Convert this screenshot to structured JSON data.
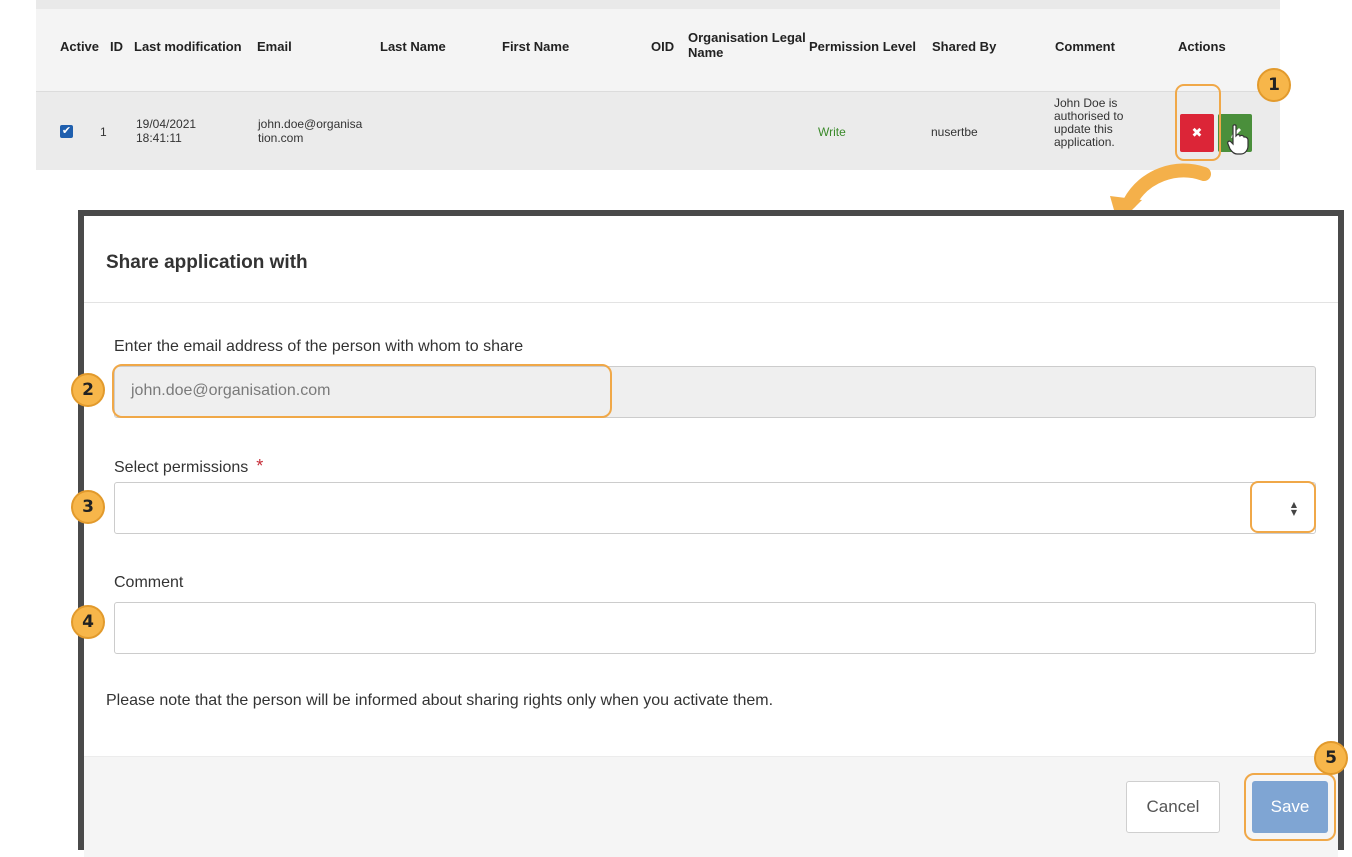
{
  "table": {
    "headers": {
      "active": "Active",
      "id": "ID",
      "last_modification": "Last modification",
      "email": "Email",
      "last_name": "Last Name",
      "first_name": "First Name",
      "oid": "OID",
      "org_legal_name_1": "Organisation Legal",
      "org_legal_name_2": "Name",
      "permission_level": "Permission Level",
      "shared_by": "Shared By",
      "comment": "Comment",
      "actions": "Actions"
    },
    "rows": [
      {
        "active": true,
        "id": "1",
        "last_modification_date": "19/04/2021",
        "last_modification_time": "18:41:11",
        "email_1": "john.doe@organisa",
        "email_2": "tion.com",
        "last_name": "",
        "first_name": "",
        "oid": "",
        "org_legal_name": "",
        "permission_level": "Write",
        "shared_by": "nusertbe",
        "comment_lines": [
          "John Doe is",
          "authorised to",
          "update this",
          "application."
        ]
      }
    ]
  },
  "callouts": [
    "1",
    "2",
    "3",
    "4",
    "5"
  ],
  "modal": {
    "title": "Share application with",
    "email_label": "Enter the email address of the person with whom to share",
    "email_value": "john.doe@organisation.com",
    "permissions_label": "Select permissions",
    "permissions_required_mark": "*",
    "permissions_value": "",
    "comment_label": "Comment",
    "comment_value": "",
    "note": "Please note that the person will be informed about sharing rights only when you activate them.",
    "cancel_label": "Cancel",
    "save_label": "Save"
  },
  "colors": {
    "delete_button": "#dc2537",
    "edit_button": "#4a8f3b",
    "permission_write": "#3a8a2a",
    "callout": "#f7b64a",
    "required": "#c52a35",
    "save_button": "#7fa5d3"
  },
  "icons": {
    "checkbox": "check-icon",
    "delete": "close-icon",
    "edit": "pencil-icon",
    "select": "sort-arrows-icon",
    "cursor": "hand-pointer-icon"
  }
}
